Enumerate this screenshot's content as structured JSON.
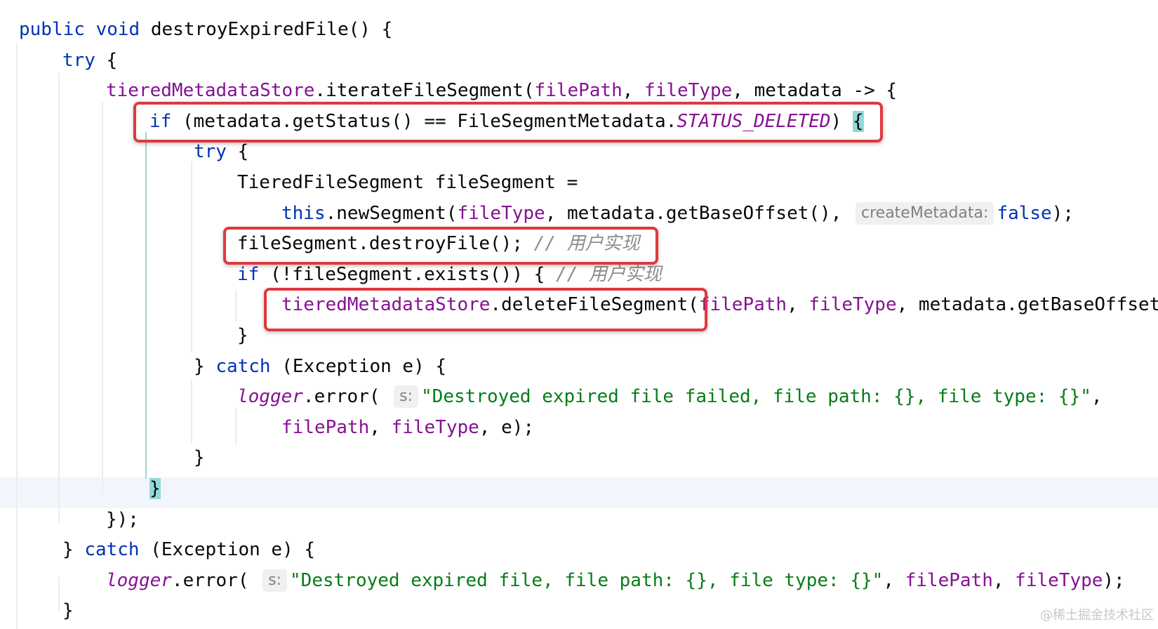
{
  "lines": [
    {
      "parts": [
        {
          "t": "public",
          "c": "kw"
        },
        {
          "t": " "
        },
        {
          "t": "void",
          "c": "kw"
        },
        {
          "t": " destroyExpiredFile() {"
        }
      ]
    },
    {
      "parts": [
        {
          "t": "try",
          "c": "kw"
        },
        {
          "t": " {"
        }
      ]
    },
    {
      "parts": [
        {
          "t": "tieredMetadataStore",
          "c": "fld"
        },
        {
          "t": ".iterateFileSegment("
        },
        {
          "t": "filePath",
          "c": "fld"
        },
        {
          "t": ", "
        },
        {
          "t": "fileType",
          "c": "fld"
        },
        {
          "t": ", metadata -> {"
        }
      ]
    },
    {
      "parts": [
        {
          "t": "if",
          "c": "kw"
        },
        {
          "t": " (metadata.getStatus() == FileSegmentMetadata."
        },
        {
          "t": "STATUS_DELETED",
          "c": "const"
        },
        {
          "t": ") "
        },
        {
          "t": "{",
          "c": "brace-hl"
        }
      ]
    },
    {
      "parts": [
        {
          "t": "try",
          "c": "kw"
        },
        {
          "t": " {"
        }
      ]
    },
    {
      "parts": [
        {
          "t": "TieredFileSegment fileSegment ="
        }
      ]
    },
    {
      "parts": [
        {
          "t": "this",
          "c": "kw"
        },
        {
          "t": ".newSegment("
        },
        {
          "t": "fileType",
          "c": "fld"
        },
        {
          "t": ", metadata.getBaseOffset(), "
        },
        {
          "t": "createMetadata:",
          "c": "hint"
        },
        {
          "t": "false",
          "c": "kw"
        },
        {
          "t": ");"
        }
      ]
    },
    {
      "parts": [
        {
          "t": "fileSegment.destroyFile(); "
        },
        {
          "t": "// 用户实现",
          "c": "cmt"
        }
      ]
    },
    {
      "parts": [
        {
          "t": "if",
          "c": "kw"
        },
        {
          "t": " (!fileSegment.exists()) { "
        },
        {
          "t": "// 用户实现",
          "c": "cmt"
        }
      ]
    },
    {
      "parts": [
        {
          "t": "tieredMetadataStore",
          "c": "fld"
        },
        {
          "t": ".deleteFileSegment("
        },
        {
          "t": "filePath",
          "c": "fld"
        },
        {
          "t": ", "
        },
        {
          "t": "fileType",
          "c": "fld"
        },
        {
          "t": ", metadata.getBaseOffset"
        }
      ]
    },
    {
      "parts": [
        {
          "t": "}"
        }
      ]
    },
    {
      "parts": [
        {
          "t": "} "
        },
        {
          "t": "catch",
          "c": "kw"
        },
        {
          "t": " (Exception e) {"
        }
      ]
    },
    {
      "parts": [
        {
          "t": "logger",
          "c": "const"
        },
        {
          "t": ".error( "
        },
        {
          "t": "s:",
          "c": "hint"
        },
        {
          "t": "\"Destroyed expired file failed, file path: {}, file type: {}\"",
          "c": "str"
        },
        {
          "t": ","
        }
      ]
    },
    {
      "parts": [
        {
          "t": "filePath",
          "c": "fld"
        },
        {
          "t": ", "
        },
        {
          "t": "fileType",
          "c": "fld"
        },
        {
          "t": ", e);"
        }
      ]
    },
    {
      "parts": [
        {
          "t": "}"
        }
      ]
    },
    {
      "parts": [
        {
          "t": "}",
          "c": "brace-hl"
        }
      ]
    },
    {
      "parts": [
        {
          "t": "});"
        }
      ]
    },
    {
      "parts": [
        {
          "t": "} "
        },
        {
          "t": "catch",
          "c": "kw"
        },
        {
          "t": " (Exception e) {"
        }
      ]
    },
    {
      "parts": [
        {
          "t": "logger",
          "c": "const"
        },
        {
          "t": ".error( "
        },
        {
          "t": "s:",
          "c": "hint"
        },
        {
          "t": "\"Destroyed expired file, file path: {}, file type: {}\"",
          "c": "str"
        },
        {
          "t": ", "
        },
        {
          "t": "filePath",
          "c": "fld"
        },
        {
          "t": ", "
        },
        {
          "t": "fileType",
          "c": "fld"
        },
        {
          "t": ");"
        }
      ]
    },
    {
      "parts": [
        {
          "t": "}"
        }
      ]
    }
  ],
  "watermark": "@稀土掘金技术社区"
}
